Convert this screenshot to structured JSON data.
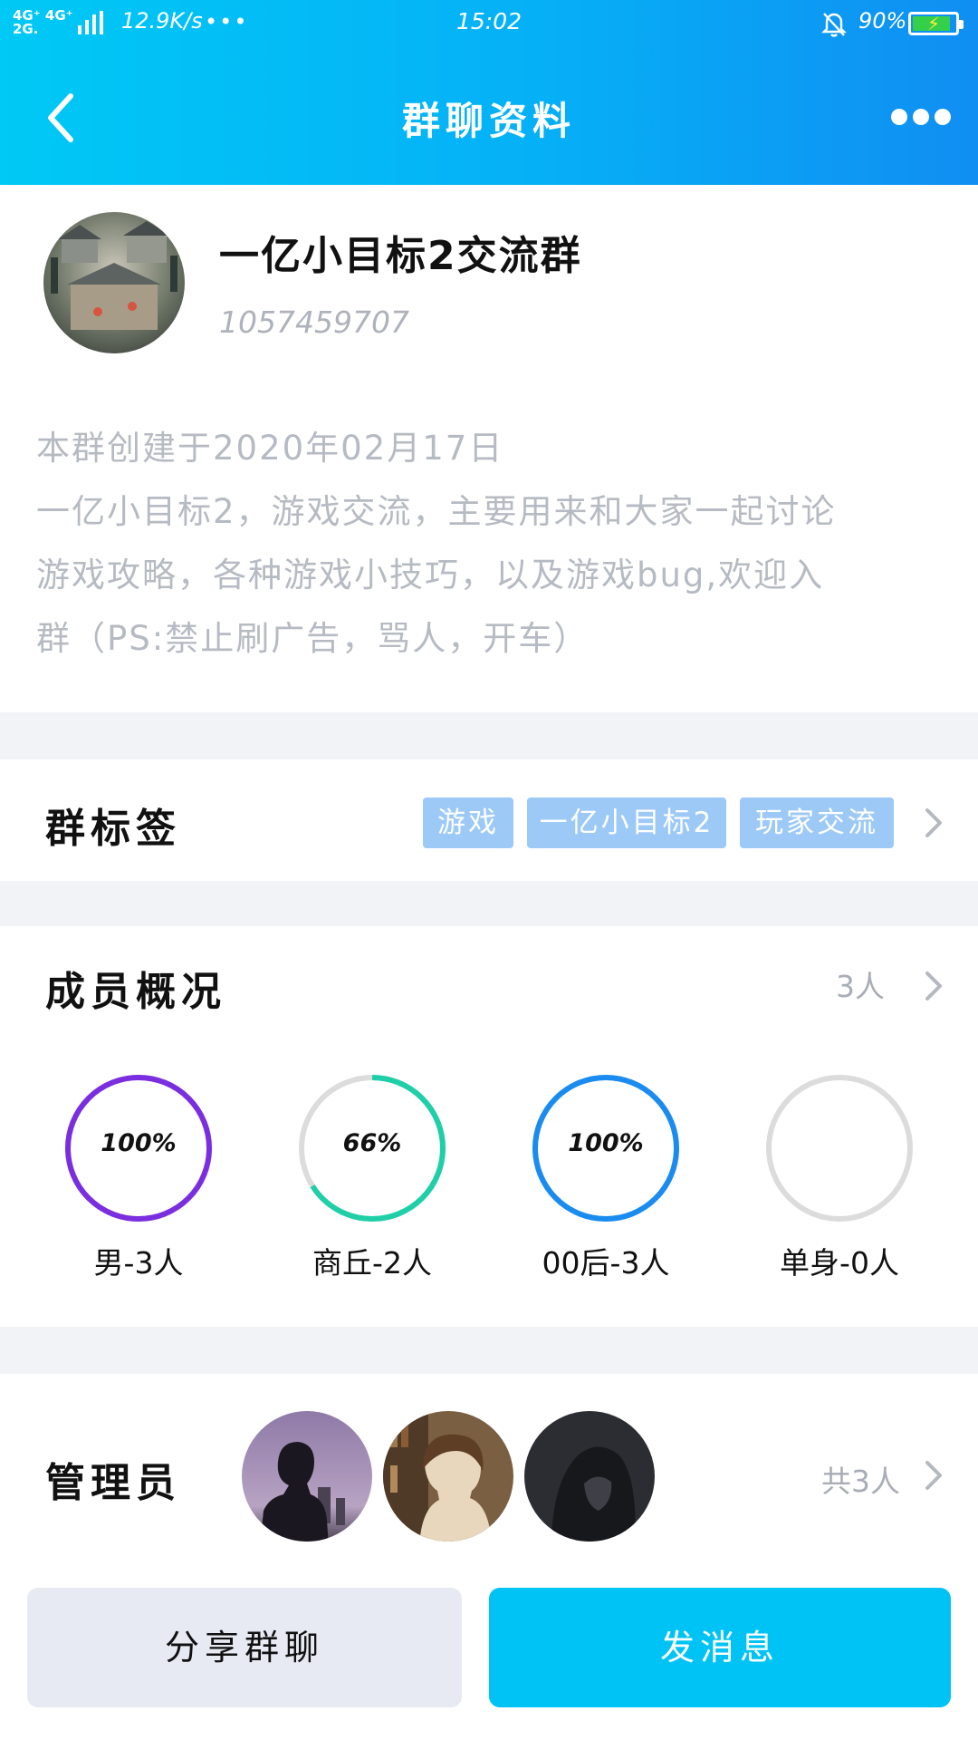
{
  "status_bar": {
    "network_top": "4G⁺ 4G⁺",
    "network_bottom": "2G.",
    "speed": "12.9K/s",
    "more": "•••",
    "time": "15:02",
    "battery": "90%",
    "battery_level": 0.9
  },
  "nav": {
    "title": "群聊资料",
    "back_icon": "chevron-left-icon",
    "more_icon": "more-dots-icon"
  },
  "group": {
    "name": "一亿小目标2交流群",
    "id": "1057459707",
    "description": [
      "本群创建于2020年02月17日",
      "一亿小目标2，游戏交流，主要用来和大家一起讨论",
      "游戏攻略，各种游戏小技巧，以及游戏bug,欢迎入",
      "群（PS:禁止刷广告，骂人，开车）"
    ]
  },
  "tags": {
    "label": "群标签",
    "items": [
      "游戏",
      "一亿小目标2",
      "玩家交流"
    ]
  },
  "members": {
    "label": "成员概况",
    "count": "3人",
    "stats": [
      {
        "value": "100%",
        "caption": "男-3人",
        "fraction": 1.0,
        "color": "#7a2ee0"
      },
      {
        "value": "66%",
        "caption": "商丘-2人",
        "fraction": 0.66,
        "color": "#1fcfa8"
      },
      {
        "value": "100%",
        "caption": "00后-3人",
        "fraction": 1.0,
        "color": "#1a8cf0"
      },
      {
        "value": "",
        "caption": "单身-0人",
        "fraction": 0.0,
        "color": "#dcdcdc"
      }
    ]
  },
  "admins": {
    "label": "管理员",
    "count": "共3人"
  },
  "actions": {
    "share": "分享群聊",
    "send": "发消息"
  },
  "colors": {
    "header_start": "#00c9f5",
    "header_end": "#108ef2",
    "accent": "#00c3f5",
    "tag_bg": "#9dc9f7"
  }
}
